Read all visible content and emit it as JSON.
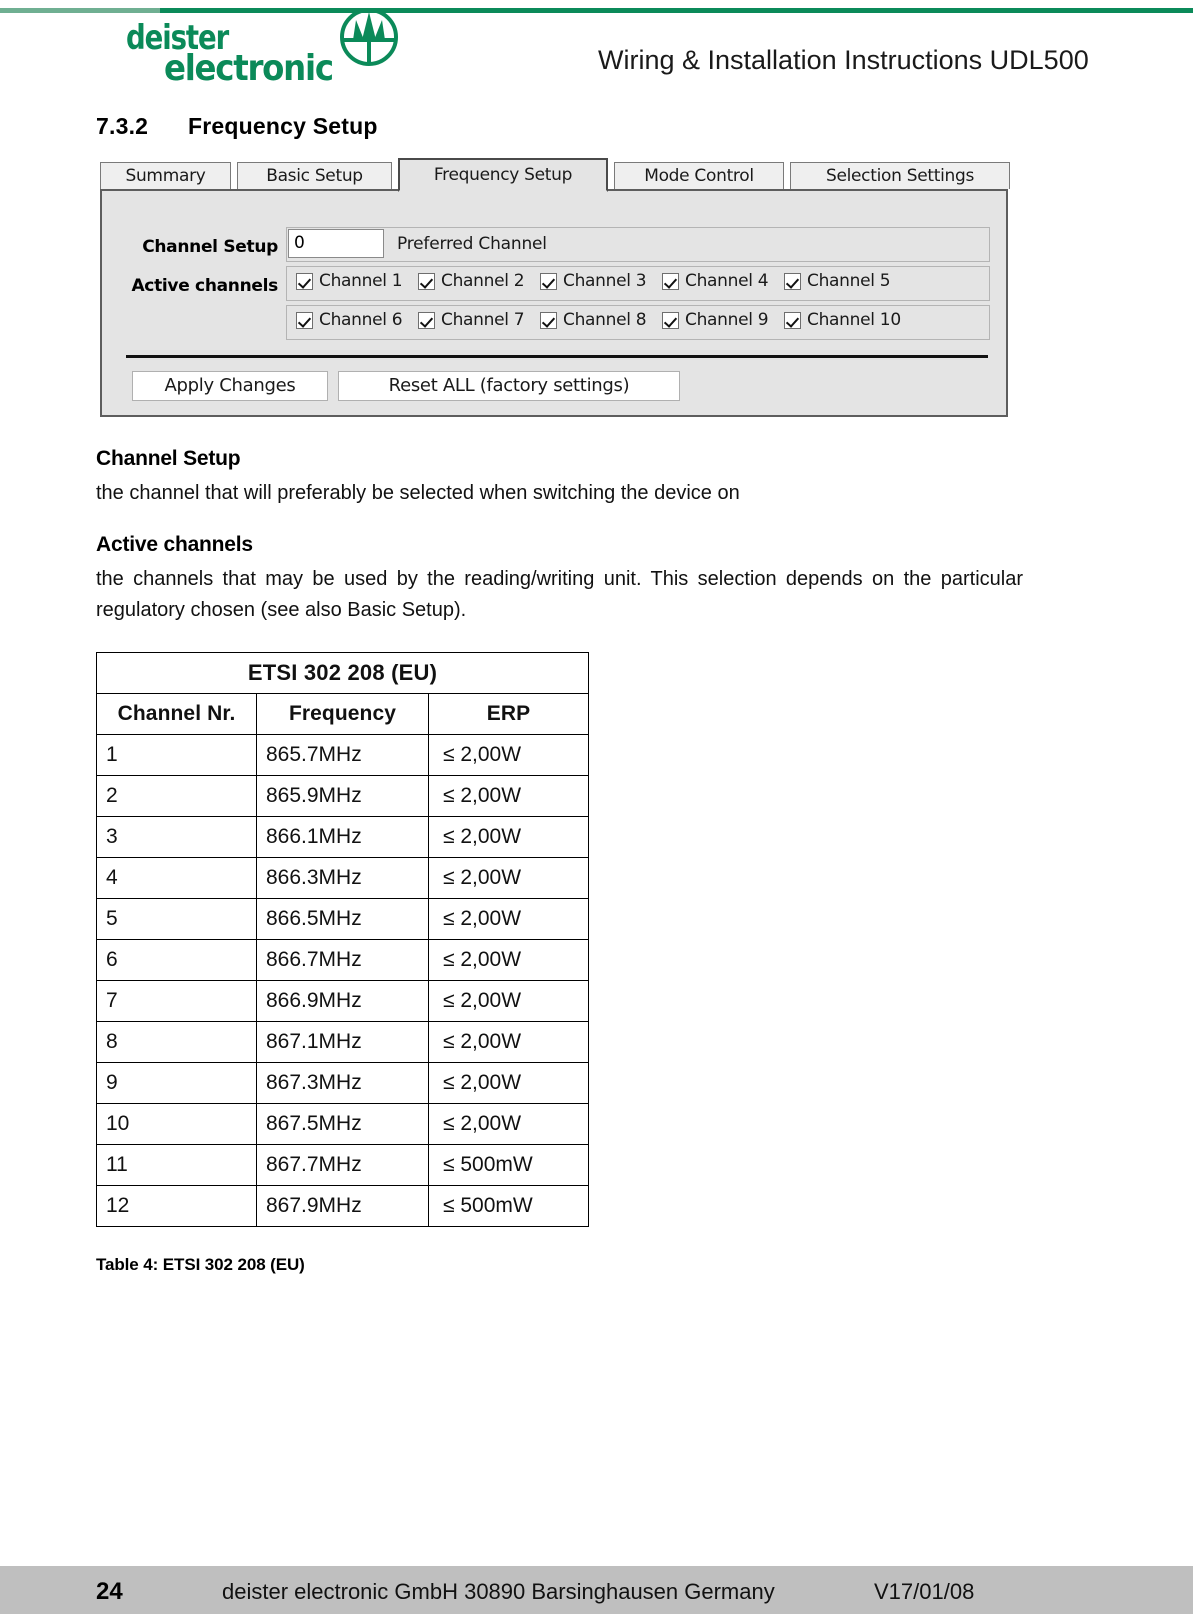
{
  "header": {
    "logo_line1": "deister",
    "logo_line2": "electronic",
    "logo_emblem_icon": "deister-tree-circle-emblem",
    "title": "Wiring & Installation Instructions UDL500",
    "brand_green": "#0b8a59"
  },
  "section": {
    "number": "7.3.2",
    "title": "Frequency Setup"
  },
  "screenshot": {
    "tabs": [
      {
        "label": "Summary",
        "active": false
      },
      {
        "label": "Basic Setup",
        "active": false
      },
      {
        "label": "Frequency Setup",
        "active": true
      },
      {
        "label": "Mode Control",
        "active": false
      },
      {
        "label": "Selection Settings",
        "active": false
      }
    ],
    "channel_setup": {
      "label": "Channel Setup",
      "input_value": "0",
      "input_placeholder": "0",
      "static_label": "Preferred Channel"
    },
    "active_channels": {
      "label": "Active channels",
      "row1": [
        {
          "label": "Channel 1",
          "checked": true
        },
        {
          "label": "Channel 2",
          "checked": true
        },
        {
          "label": "Channel 3",
          "checked": true
        },
        {
          "label": "Channel 4",
          "checked": true
        },
        {
          "label": "Channel 5",
          "checked": true
        }
      ],
      "row2": [
        {
          "label": "Channel 6",
          "checked": true
        },
        {
          "label": "Channel 7",
          "checked": true
        },
        {
          "label": "Channel 8",
          "checked": true
        },
        {
          "label": "Channel 9",
          "checked": true
        },
        {
          "label": "Channel 10",
          "checked": true
        }
      ]
    },
    "buttons": {
      "apply": "Apply Changes",
      "reset": "Reset ALL (factory settings)"
    }
  },
  "content": {
    "channel_setup_heading": "Channel Setup",
    "channel_setup_text": "the channel that will preferably be selected when switching the device on",
    "active_channels_heading": "Active channels",
    "active_channels_text": "the channels that may be used by the reading/writing unit. This selection depends on the particular regulatory chosen (see also Basic Setup)."
  },
  "table": {
    "title": "ETSI 302 208 (EU)",
    "columns": [
      "Channel Nr.",
      "Frequency",
      "ERP"
    ],
    "rows": [
      [
        "1",
        "865.7MHz",
        "≤ 2,00W"
      ],
      [
        "2",
        "865.9MHz",
        "≤ 2,00W"
      ],
      [
        "3",
        "866.1MHz",
        "≤ 2,00W"
      ],
      [
        "4",
        "866.3MHz",
        "≤ 2,00W"
      ],
      [
        "5",
        "866.5MHz",
        "≤ 2,00W"
      ],
      [
        "6",
        "866.7MHz",
        "≤ 2,00W"
      ],
      [
        "7",
        "866.9MHz",
        "≤ 2,00W"
      ],
      [
        "8",
        "867.1MHz",
        "≤ 2,00W"
      ],
      [
        "9",
        "867.3MHz",
        "≤ 2,00W"
      ],
      [
        "10",
        "867.5MHz",
        "≤ 2,00W"
      ],
      [
        "11",
        "867.7MHz",
        "≤ 500mW"
      ],
      [
        "12",
        "867.9MHz",
        "≤ 500mW"
      ]
    ],
    "caption": "Table 4: ETSI 302 208 (EU)"
  },
  "footer": {
    "page_number": "24",
    "company": "deister electronic GmbH  30890 Barsinghausen  Germany",
    "version": "V17/01/08"
  }
}
